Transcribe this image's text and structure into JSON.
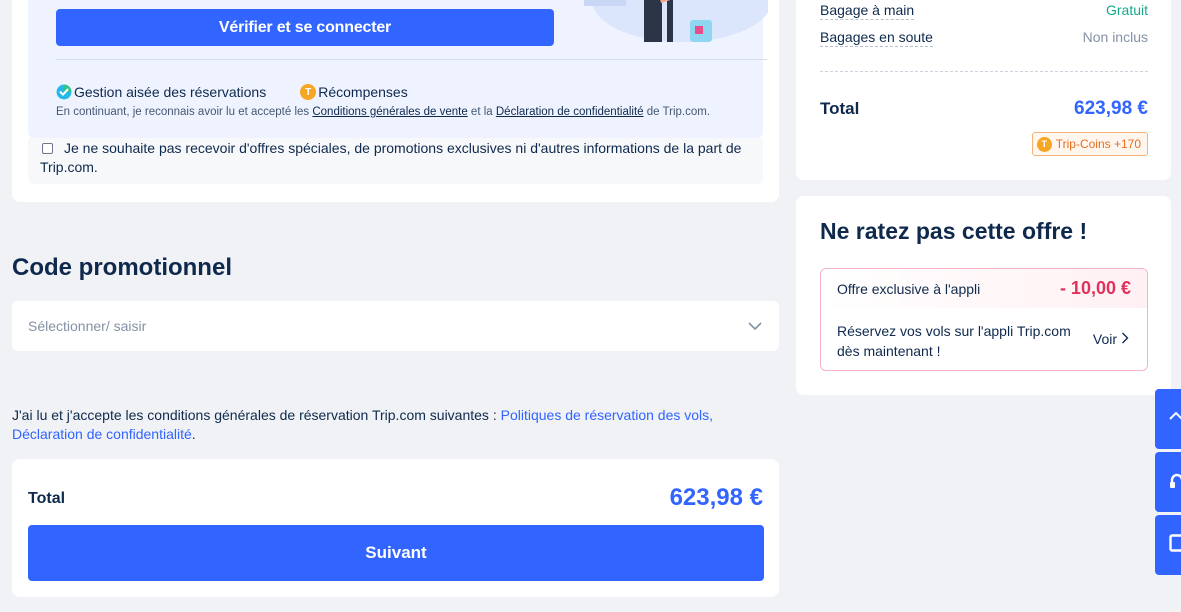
{
  "login": {
    "verify_button": "Vérifier et se connecter",
    "benefit_1": "Gestion aisée des réservations",
    "benefit_2": "Récompenses",
    "terms_prefix": "En continuant, je reconnais avoir lu et accepté les",
    "terms_link": "Conditions générales de vente",
    "terms_and": "et la",
    "privacy_link": "Déclaration de confidentialité",
    "terms_suffix": "de Trip.com.",
    "optout_text": "Je ne souhaite pas recevoir d'offres spéciales, de promotions exclusives ni d'autres informations de la part de Trip.com."
  },
  "promo": {
    "title": "Code promotionnel",
    "placeholder": "Sélectionner/ saisir"
  },
  "acceptance": {
    "text": "J'ai lu et j'accepte les conditions générales de réservation Trip.com suivantes :",
    "links": "Politiques de réservation des vols, Déclaration de confidentialité",
    "end": "."
  },
  "bottom_total": {
    "label": "Total",
    "value": "623,98 €",
    "next_button": "Suivant"
  },
  "summary": {
    "hand_baggage_label": "Bagage à main",
    "hand_baggage_value": "Gratuit",
    "checked_baggage_label": "Bagages en soute",
    "checked_baggage_value": "Non inclus",
    "total_label": "Total",
    "total_value": "623,98 €",
    "coins_badge": "Trip-Coins +170"
  },
  "offer": {
    "title": "Ne ratez pas cette offre !",
    "app_label": "Offre exclusive à l'appli",
    "app_discount": "- 10,00 €",
    "body": "Réservez vos vols sur l'appli Trip.com dès maintenant !",
    "link": "Voir"
  },
  "colors": {
    "primary": "#3264ff",
    "free_green": "#17a88a",
    "discount_red": "#e0325d",
    "coin_orange": "#f5a623"
  }
}
